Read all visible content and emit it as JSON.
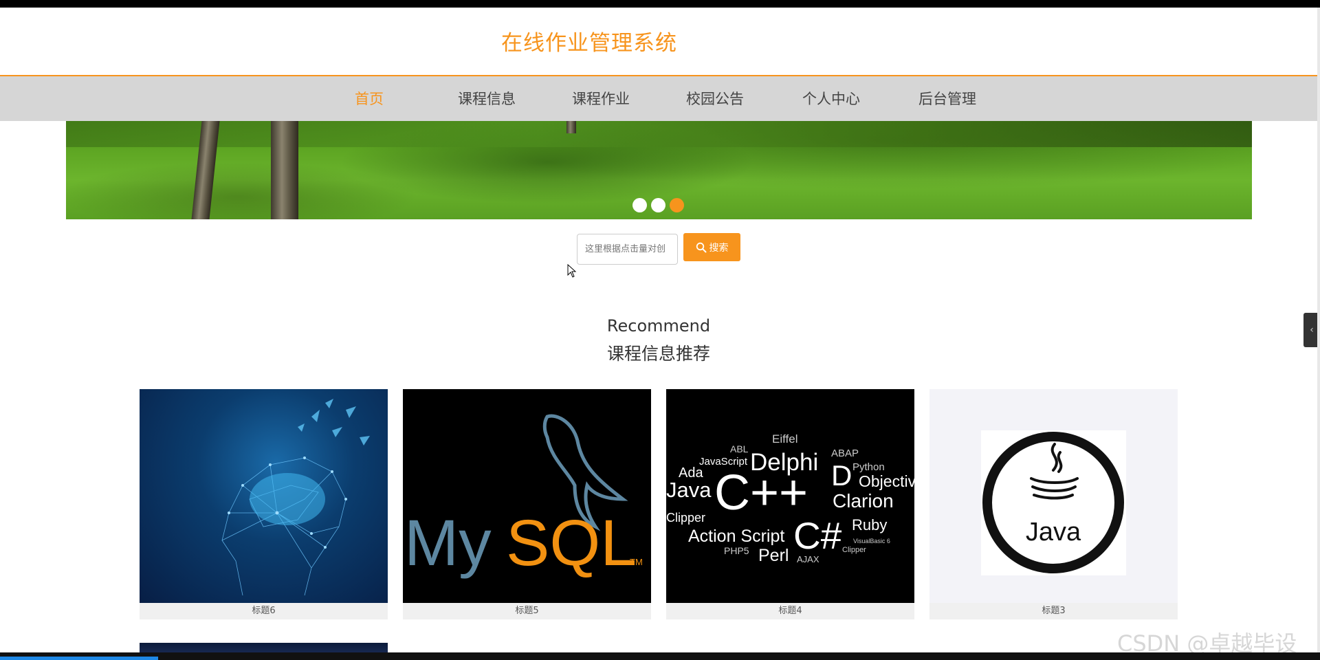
{
  "header": {
    "title": "在线作业管理系统"
  },
  "nav": {
    "items": [
      {
        "label": "首页",
        "active": true
      },
      {
        "label": "课程信息",
        "active": false
      },
      {
        "label": "课程作业",
        "active": false
      },
      {
        "label": "校园公告",
        "active": false
      },
      {
        "label": "个人中心",
        "active": false
      },
      {
        "label": "后台管理",
        "active": false
      }
    ]
  },
  "banner": {
    "dots": 3,
    "active_dot": 3
  },
  "search": {
    "placeholder": "这里根据点击量对创",
    "button_label": "搜索",
    "icon": "search-icon"
  },
  "section": {
    "title_en": "Recommend",
    "title_cn": "课程信息推荐"
  },
  "cards": [
    {
      "caption": "标题6",
      "image": "brain-network"
    },
    {
      "caption": "标题5",
      "image": "mysql-logo"
    },
    {
      "caption": "标题4",
      "image": "programming-languages-wordcloud"
    },
    {
      "caption": "标题3",
      "image": "java-logo"
    }
  ],
  "mysql_logo": {
    "my": "My",
    "sql": "SQL",
    "tm": "TM"
  },
  "wordcloud": {
    "words": [
      "Eiffel",
      "ABL",
      "JavaScript",
      "Delphi",
      "ABAP",
      "Python",
      "Ada",
      "Java",
      "C++",
      "D",
      "Objective",
      "Clarion",
      "Clipper",
      "Action Script",
      "C#",
      "Ruby",
      "PHP5",
      "Perl",
      "AJAX",
      "VisualBasic 6",
      "Clipper"
    ]
  },
  "java_logo": {
    "text": "Java"
  },
  "watermark": "CSDN @卓越毕设",
  "colors": {
    "accent": "#f7941d",
    "nav_bg": "#d6d6d6"
  }
}
